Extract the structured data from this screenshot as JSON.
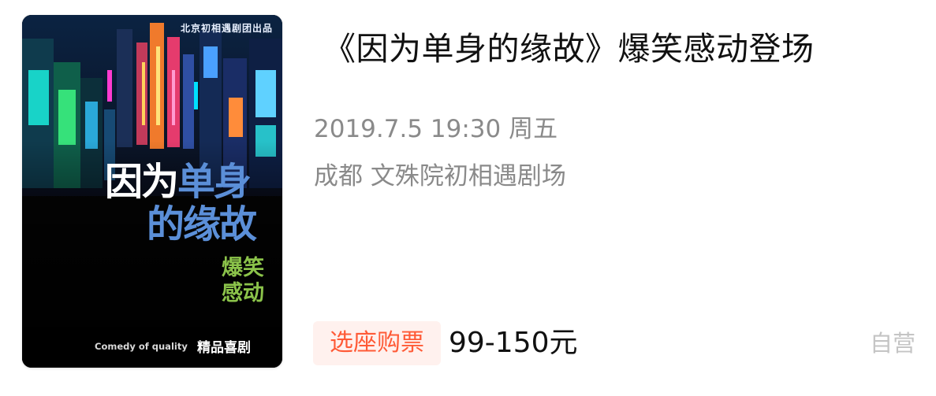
{
  "event": {
    "title": "《因为单身的缘故》爆笑感动登场",
    "datetime": "2019.7.5 19:30 周五",
    "venue": "成都 文殊院初相遇剧场",
    "buy_label": "选座购票",
    "price": "99-150元",
    "self_run_label": "自营"
  },
  "poster": {
    "presenter": "北京初相遇剧团出品",
    "title_line1_white": "因为",
    "title_line1_blue": "单身",
    "title_line2": "的缘故",
    "tag_line1": "爆笑",
    "tag_line2": "感动",
    "comedy_text": "Comedy of quality",
    "genre": "精品喜剧"
  },
  "colors": {
    "accent": "#ff5a36",
    "badge_bg": "#fff1ee",
    "muted_text": "#8a8a8a",
    "title_text": "#111111",
    "poster_blue": "#5b8fd8",
    "poster_green": "#8bc34a"
  }
}
